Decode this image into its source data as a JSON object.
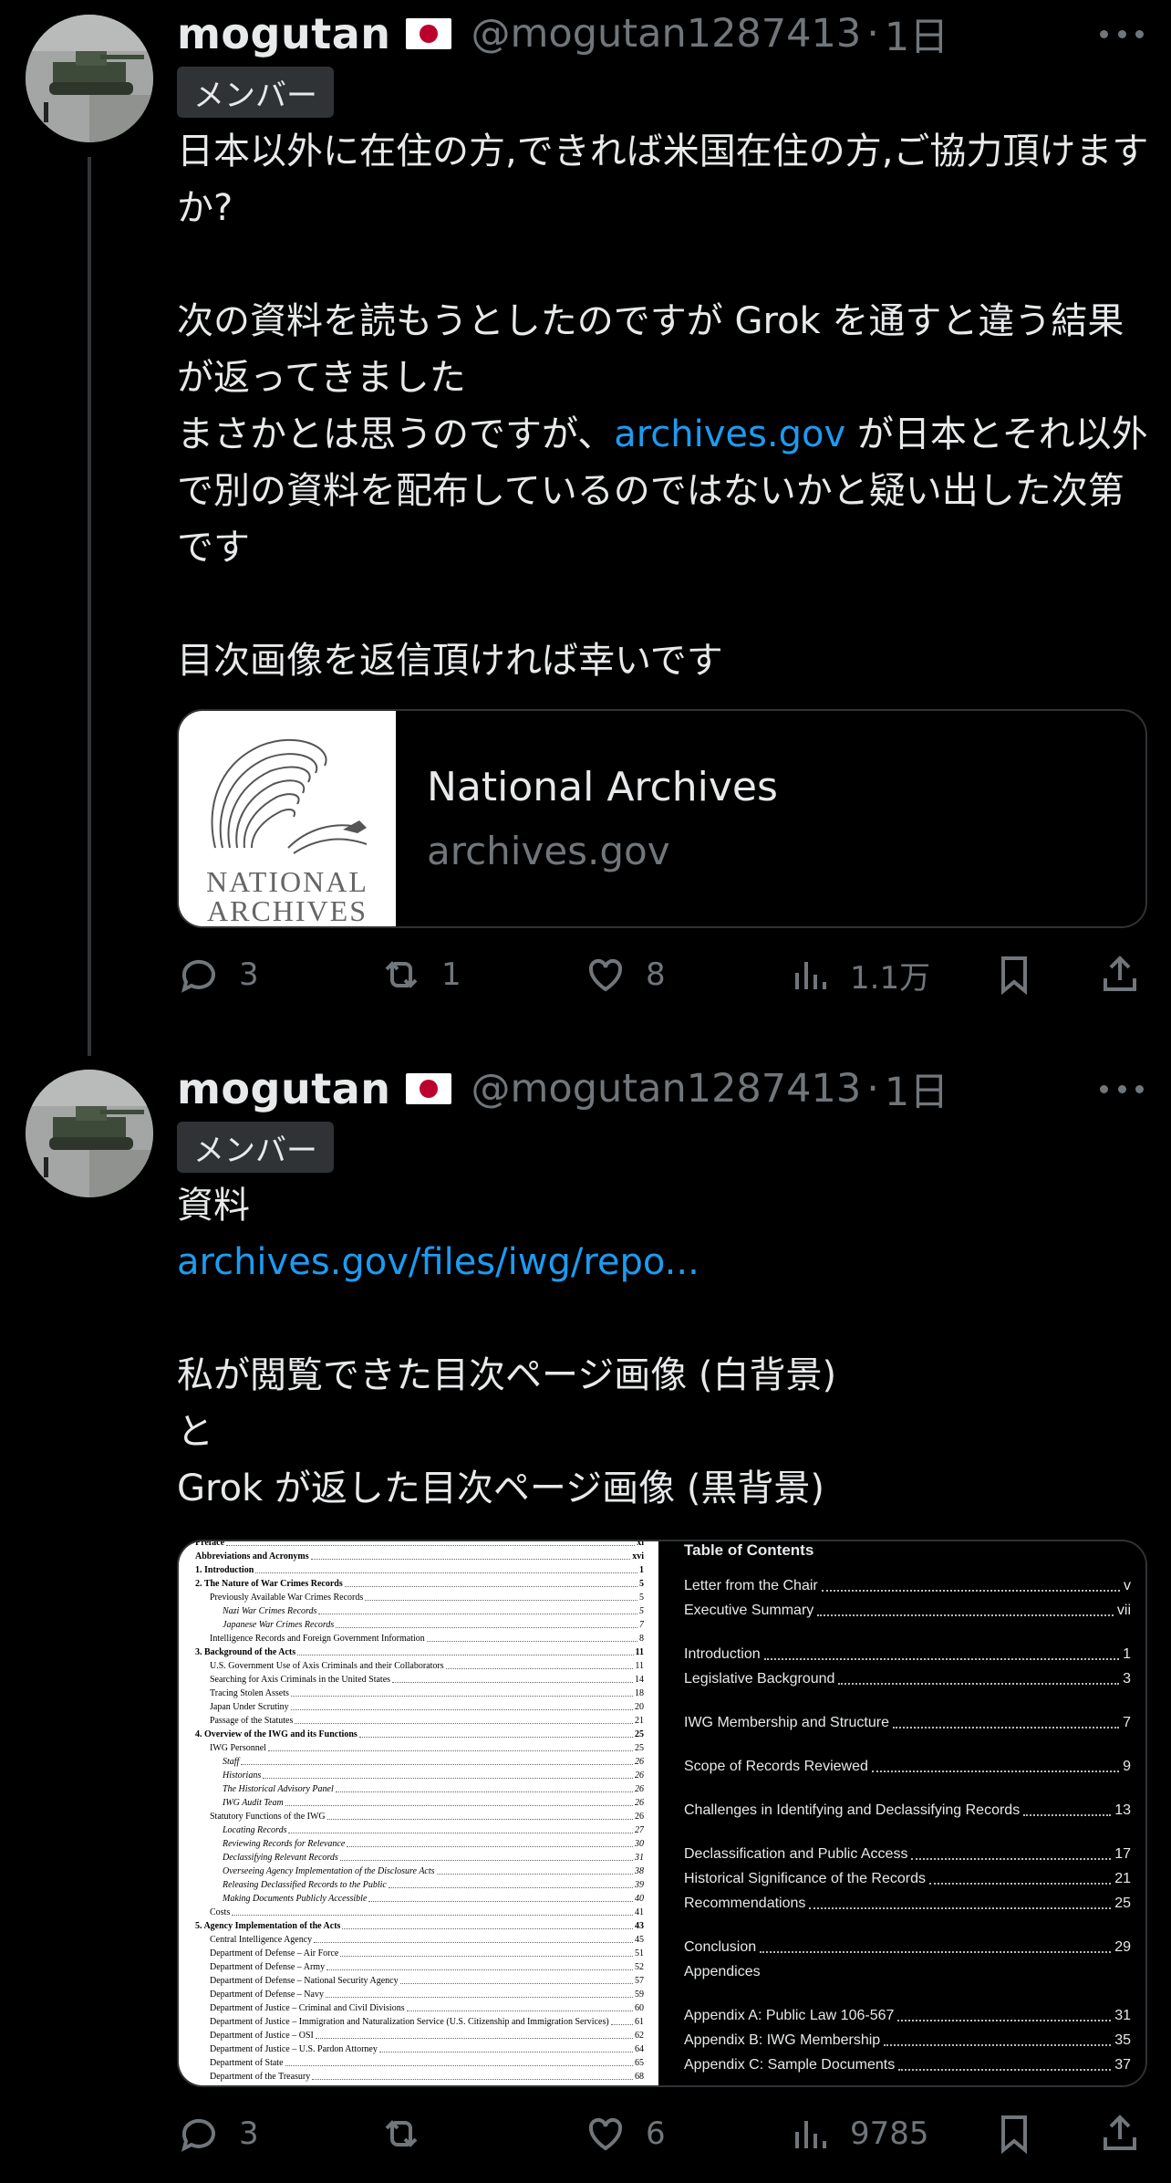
{
  "tweets": [
    {
      "author_name": "mogutan",
      "handle": "@mogutan1287413",
      "separator": "·",
      "time": "1日",
      "badge": "メンバー",
      "text_before_link": "日本以外に在住の方,できれば米国在住の方,ご協力頂けますか?\n\n次の資料を読もうとしたのですが Grok を通すと違う結果が返ってきました\nまさかとは思うのですが、",
      "link_text": "archives.gov",
      "text_after_link": " が日本とそれ以外で別の資料を配布しているのではないかと疑い出した次第です\n\n目次画像を返信頂ければ幸いです",
      "card": {
        "logo_line1": "NATIONAL",
        "logo_line2": "ARCHIVES",
        "title": "National Archives",
        "domain": "archives.gov"
      },
      "actions": {
        "replies": "3",
        "reposts": "1",
        "likes": "8",
        "views": "1.1万"
      }
    },
    {
      "author_name": "mogutan",
      "handle": "@mogutan1287413",
      "separator": "·",
      "time": "1日",
      "badge": "メンバー",
      "line1": "資料",
      "link_text": "archives.gov/files/iwg/repo...",
      "text_after_link": "\n\n私が閲覧できた目次ページ画像 (白背景)\nと\nGrok が返した目次ページ画像 (黒背景)",
      "actions": {
        "replies": "3",
        "reposts": "",
        "likes": "6",
        "views": "9785"
      }
    }
  ],
  "toc_white": [
    {
      "t": "Preface",
      "p": "xi",
      "s": "b"
    },
    {
      "t": "Abbreviations and Acronyms",
      "p": "xvi",
      "s": "b"
    },
    {
      "t": "1. Introduction",
      "p": "1",
      "s": "b"
    },
    {
      "t": "2. The Nature of War Crimes Records",
      "p": "5",
      "s": "b"
    },
    {
      "t": "Previously Available War Crimes Records",
      "p": "5",
      "s": "n1"
    },
    {
      "t": "Nazi War Crimes Records",
      "p": "5",
      "s": "i2"
    },
    {
      "t": "Japanese War Crimes Records",
      "p": "7",
      "s": "i2"
    },
    {
      "t": "Intelligence Records and Foreign Government Information",
      "p": "8",
      "s": "n1"
    },
    {
      "t": "3. Background of the Acts",
      "p": "11",
      "s": "b"
    },
    {
      "t": "U.S. Government Use of Axis Criminals and their Collaborators",
      "p": "11",
      "s": "n1"
    },
    {
      "t": "Searching for Axis Criminals in the United States",
      "p": "14",
      "s": "n1"
    },
    {
      "t": "Tracing Stolen Assets",
      "p": "18",
      "s": "n1"
    },
    {
      "t": "Japan Under Scrutiny",
      "p": "20",
      "s": "n1"
    },
    {
      "t": "Passage of the Statutes",
      "p": "21",
      "s": "n1"
    },
    {
      "t": "4. Overview of the IWG and its Functions",
      "p": "25",
      "s": "b"
    },
    {
      "t": "IWG Personnel",
      "p": "25",
      "s": "n1"
    },
    {
      "t": "Staff",
      "p": "26",
      "s": "i2"
    },
    {
      "t": "Historians",
      "p": "26",
      "s": "i2"
    },
    {
      "t": "The Historical Advisory Panel",
      "p": "26",
      "s": "i2"
    },
    {
      "t": "IWG Audit Team",
      "p": "26",
      "s": "i2"
    },
    {
      "t": "Statutory Functions of the IWG",
      "p": "26",
      "s": "n1"
    },
    {
      "t": "Locating Records",
      "p": "27",
      "s": "i2"
    },
    {
      "t": "Reviewing Records for Relevance",
      "p": "30",
      "s": "i2"
    },
    {
      "t": "Declassifying Relevant Records",
      "p": "31",
      "s": "i2"
    },
    {
      "t": "Overseeing Agency Implementation of the Disclosure Acts",
      "p": "38",
      "s": "i2"
    },
    {
      "t": "Releasing Declassified Records to the Public",
      "p": "39",
      "s": "i2"
    },
    {
      "t": "Making Documents Publicly Accessible",
      "p": "40",
      "s": "i2"
    },
    {
      "t": "Costs",
      "p": "41",
      "s": "n1"
    },
    {
      "t": "5. Agency Implementation of the Acts",
      "p": "43",
      "s": "b"
    },
    {
      "t": "Central Intelligence Agency",
      "p": "45",
      "s": "n1"
    },
    {
      "t": "Department of Defense – Air Force",
      "p": "51",
      "s": "n1"
    },
    {
      "t": "Department of Defense – Army",
      "p": "52",
      "s": "n1"
    },
    {
      "t": "Department of Defense – National Security Agency",
      "p": "57",
      "s": "n1"
    },
    {
      "t": "Department of Defense – Navy",
      "p": "59",
      "s": "n1"
    },
    {
      "t": "Department of Justice – Criminal and Civil Divisions",
      "p": "60",
      "s": "n1"
    },
    {
      "t": "Department of Justice – Immigration and Naturalization Service (U.S. Citizenship and Immigration Services)",
      "p": "61",
      "s": "n1"
    },
    {
      "t": "Department of Justice – OSI",
      "p": "62",
      "s": "n1"
    },
    {
      "t": "Department of Justice – U.S. Pardon Attorney",
      "p": "64",
      "s": "n1"
    },
    {
      "t": "Department of State",
      "p": "65",
      "s": "n1"
    },
    {
      "t": "Department of the Treasury",
      "p": "68",
      "s": "n1"
    }
  ],
  "toc_black_title": "Table of Contents",
  "toc_black": [
    {
      "t": "Letter from the Chair",
      "p": "v"
    },
    {
      "t": "Executive Summary",
      "p": "vii"
    },
    {
      "t": "Introduction",
      "p": "1"
    },
    {
      "t": "Legislative Background",
      "p": "3"
    },
    {
      "t": "IWG Membership and Structure",
      "p": "7"
    },
    {
      "t": "Scope of Records Reviewed",
      "p": "9"
    },
    {
      "t": "Challenges in Identifying and Declassifying Records",
      "p": "13"
    },
    {
      "t": "Declassification and Public Access",
      "p": "17"
    },
    {
      "t": "Historical Significance of the Records",
      "p": "21"
    },
    {
      "t": "Recommendations",
      "p": "25"
    },
    {
      "t": "Conclusion",
      "p": "29"
    },
    {
      "t": "Appendices",
      "p": ""
    },
    {
      "t": "Appendix A: Public Law 106-567",
      "p": "31"
    },
    {
      "t": "Appendix B: IWG Membership",
      "p": "35"
    },
    {
      "t": "Appendix C: Sample Documents",
      "p": "37"
    }
  ],
  "colors": {
    "background": "#000000",
    "text": "#e7e9ea",
    "muted": "#71767b",
    "link": "#1d9bf0",
    "border": "#2f3336"
  }
}
